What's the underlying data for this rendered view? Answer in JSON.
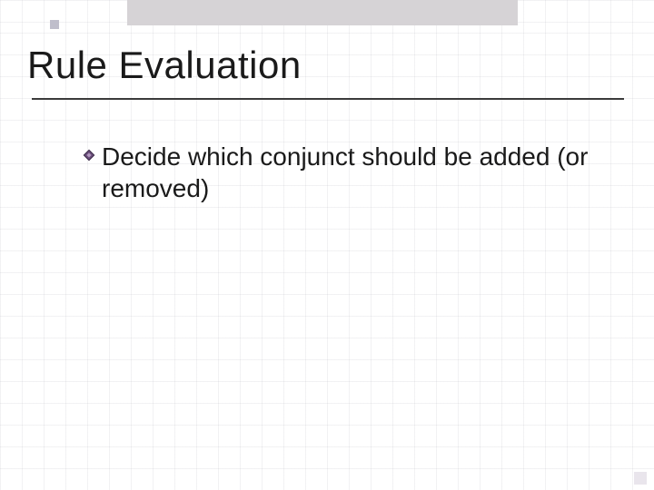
{
  "slide": {
    "title": "Rule Evaluation",
    "bullets": [
      {
        "text": "Decide which conjunct should be added (or removed)"
      }
    ]
  },
  "colors": {
    "grid": "#b9b9c2",
    "band": "#d6d3d6",
    "underline": "#3b3b3b",
    "bullet_fill": "#6a4d7a",
    "bullet_edge": "#3a2b47"
  }
}
